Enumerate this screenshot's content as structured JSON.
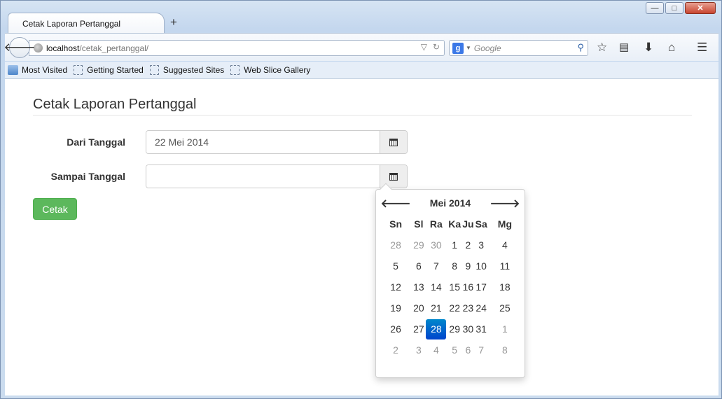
{
  "browser": {
    "tab_title": "Cetak Laporan Pertanggal",
    "new_tab": "+",
    "url_host": "localhost",
    "url_path": "/cetak_pertanggal/",
    "search_placeholder": "Google",
    "search_engine_letter": "g",
    "window_controls": {
      "minimize": "—",
      "maximize": "□",
      "close": "✕"
    }
  },
  "bookmarks": [
    "Most Visited",
    "Getting Started",
    "Suggested Sites",
    "Web Slice Gallery"
  ],
  "page": {
    "title": "Cetak Laporan Pertanggal",
    "from_label": "Dari Tanggal",
    "from_value": "22 Mei 2014",
    "to_label": "Sampai Tanggal",
    "to_value": "",
    "submit_label": "Cetak"
  },
  "datepicker": {
    "month_label": "Mei 2014",
    "prev": "🡐",
    "next": "🡒",
    "weekdays": [
      "Sn",
      "Sl",
      "Ra",
      "Ka",
      "Ju",
      "Sa",
      "Mg"
    ],
    "selected_day": "28",
    "weeks": [
      [
        {
          "d": "28",
          "old": true
        },
        {
          "d": "29",
          "old": true
        },
        {
          "d": "30",
          "old": true
        },
        {
          "d": "1"
        },
        {
          "d": "2"
        },
        {
          "d": "3"
        },
        {
          "d": "4"
        }
      ],
      [
        {
          "d": "5"
        },
        {
          "d": "6"
        },
        {
          "d": "7"
        },
        {
          "d": "8"
        },
        {
          "d": "9"
        },
        {
          "d": "10"
        },
        {
          "d": "11"
        }
      ],
      [
        {
          "d": "12"
        },
        {
          "d": "13"
        },
        {
          "d": "14"
        },
        {
          "d": "15"
        },
        {
          "d": "16"
        },
        {
          "d": "17"
        },
        {
          "d": "18"
        }
      ],
      [
        {
          "d": "19"
        },
        {
          "d": "20"
        },
        {
          "d": "21"
        },
        {
          "d": "22"
        },
        {
          "d": "23"
        },
        {
          "d": "24"
        },
        {
          "d": "25"
        }
      ],
      [
        {
          "d": "26"
        },
        {
          "d": "27"
        },
        {
          "d": "28",
          "active": true
        },
        {
          "d": "29"
        },
        {
          "d": "30"
        },
        {
          "d": "31"
        },
        {
          "d": "1",
          "old": true
        }
      ],
      [
        {
          "d": "2",
          "old": true
        },
        {
          "d": "3",
          "old": true
        },
        {
          "d": "4",
          "old": true
        },
        {
          "d": "5",
          "old": true
        },
        {
          "d": "6",
          "old": true
        },
        {
          "d": "7",
          "old": true
        },
        {
          "d": "8",
          "old": true
        }
      ]
    ]
  },
  "colors": {
    "primary_button": "#5cb85c",
    "selected_day": "#0066cc"
  }
}
